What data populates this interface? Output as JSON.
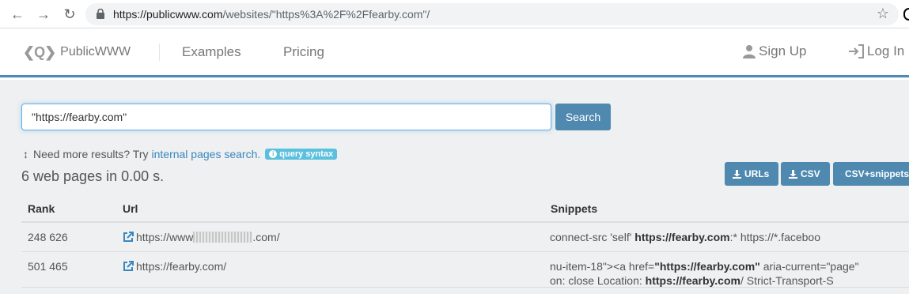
{
  "browser": {
    "url_host": "https://publicwww.com",
    "url_path": "/websites/\"https%3A%2F%2Ffearby.com\"/"
  },
  "header": {
    "logo_mark": "❮Q❯",
    "logo_text": "PublicWWW",
    "nav": [
      "Examples",
      "Pricing"
    ],
    "sign_up": "Sign Up",
    "log_in": "Log In"
  },
  "search": {
    "value": "\"https://fearby.com\"",
    "button": "Search"
  },
  "more_results": {
    "prefix": "Need more results? Try",
    "link": "internal pages search.",
    "badge": "query syntax"
  },
  "result_count": "6 web pages in 0.00 s.",
  "downloads": [
    "URLs",
    "CSV",
    "CSV+snippets"
  ],
  "table": {
    "headers": [
      "Rank",
      "Url",
      "Snippets"
    ],
    "rows": [
      {
        "rank": "248 626",
        "url_prefix": "https://www",
        "url_suffix": ".com/",
        "snippet_a": "connect-src 'self' ",
        "snippet_b": "https://fearby.com",
        "snippet_c": ":* https://*.faceboo"
      },
      {
        "rank": "501 465",
        "url": "https://fearby.com/",
        "line1_a": "nu-item-18\"><a href=",
        "line1_b": "\"https://fearby.com\"",
        "line1_c": " aria-current=\"page\"",
        "line2_a": "on: close Location: ",
        "line2_b": "https://fearby.com",
        "line2_c": "/ Strict-Transport-S"
      }
    ]
  },
  "colors": {
    "accent": "#4f89b0",
    "link": "#3a86bf",
    "badge": "#5bc0de"
  }
}
